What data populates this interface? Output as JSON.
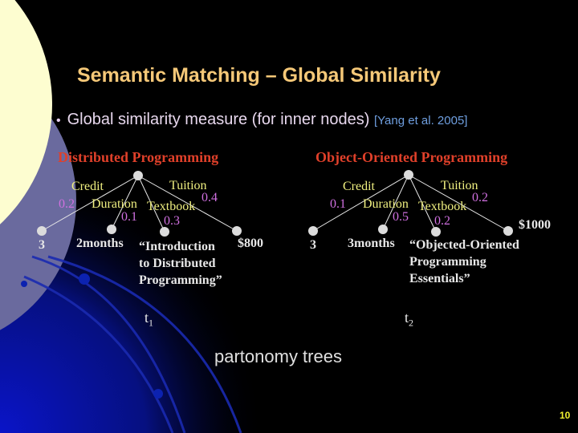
{
  "slide": {
    "title": "Semantic Matching – Global Similarity",
    "bullet": {
      "text": "Global similarity measure (for inner nodes)",
      "citation": "[Yang et al. 2005]"
    },
    "caption": "partonomy trees",
    "page_number": "10"
  },
  "trees": [
    {
      "title": "Distributed Programming",
      "label": "t",
      "label_sub": "1",
      "edges": [
        {
          "label": "Credit",
          "weight": "0.2",
          "leaf": "3"
        },
        {
          "label": "Duration",
          "weight": "0.1",
          "leaf": "2months"
        },
        {
          "label": "Textbook",
          "weight": "0.3",
          "leaf_lines": [
            "“Introduction",
            "to Distributed",
            "Programming”"
          ]
        },
        {
          "label": "Tuition",
          "weight": "0.4",
          "leaf": "$800"
        }
      ]
    },
    {
      "title": "Object-Oriented Programming",
      "label": "t",
      "label_sub": "2",
      "edges": [
        {
          "label": "Credit",
          "weight": "0.1",
          "leaf": "3"
        },
        {
          "label": "Duration",
          "weight": "0.5",
          "leaf": "3months"
        },
        {
          "label": "Textbook",
          "weight": "0.2",
          "leaf_lines": [
            "“Objected-Oriented",
            "Programming",
            "Essentials”"
          ]
        },
        {
          "label": "Tuition",
          "weight": "0.2",
          "leaf": "$1000"
        }
      ]
    }
  ],
  "colors": {
    "title": "#f5c878",
    "tree_title": "#e0402a",
    "edge_label": "#f0f080",
    "weight": "#d070e0",
    "leaf": "#e8e8e8",
    "citation": "#6f9fe0",
    "page_number": "#f0f030",
    "background": "#000000"
  }
}
